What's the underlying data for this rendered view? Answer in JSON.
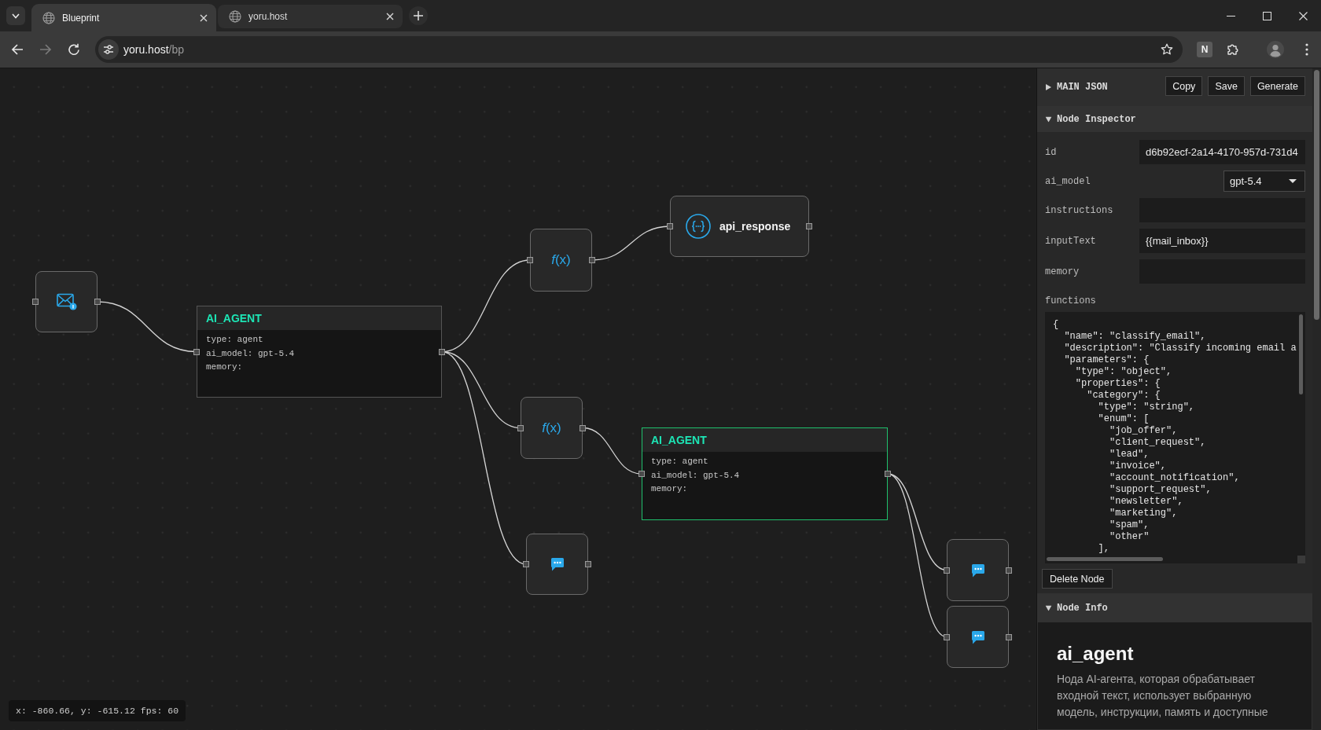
{
  "browser": {
    "tabs": [
      {
        "title": "Blueprint",
        "selected": true
      },
      {
        "title": "yoru.host",
        "selected": false
      }
    ],
    "nav_buttons": [
      {
        "kind": "back",
        "disabled": false
      },
      {
        "kind": "forward",
        "disabled": true
      },
      {
        "kind": "reload",
        "disabled": false
      }
    ],
    "address": {
      "host": "yoru.host",
      "path": "/bp"
    },
    "extension_badge": "N"
  },
  "canvas": {
    "nodes": [
      {
        "kind": "mail",
        "selected": false,
        "children": [
          {
            "kind": "agent",
            "selected": false,
            "title": "AI_AGENT",
            "fields": [
              "type: agent",
              "ai_model: gpt-5.4",
              "memory:"
            ],
            "children": [
              {
                "kind": "function",
                "selected": false,
                "label": "*f*(x)",
                "children": [
                  {
                    "kind": "response",
                    "selected": false,
                    "label": "api_response"
                  }
                ]
              },
              {
                "kind": "function",
                "selected": false,
                "label": "*f*(x)",
                "children": [
                  {
                    "kind": "agent",
                    "selected": true,
                    "title": "AI_AGENT",
                    "fields": [
                      "type: agent",
                      "ai_model: gpt-5.4",
                      "memory:"
                    ],
                    "children": [
                      {
                        "kind": "message",
                        "selected": false
                      },
                      {
                        "kind": "message",
                        "selected": false
                      }
                    ]
                  }
                ]
              },
              {
                "kind": "message",
                "selected": false
              }
            ]
          }
        ]
      }
    ],
    "status": "x: -860.66, y: -615.12 fps: 60"
  },
  "panel": {
    "main_json": {
      "title": "MAIN JSON",
      "expanded": false,
      "buttons": [
        "Copy",
        "Save",
        "Generate"
      ]
    },
    "inspector": {
      "title": "Node Inspector",
      "expanded": true,
      "fields": [
        {
          "label": "id",
          "kind": "text",
          "value": "d6b92ecf-2a14-4170-957d-731d4"
        },
        {
          "label": "ai_model",
          "kind": "select",
          "value": "gpt-5.4"
        },
        {
          "label": "instructions",
          "kind": "text"
        },
        {
          "label": "inputText",
          "kind": "text",
          "value": "{{mail_inbox}}"
        },
        {
          "label": "memory",
          "kind": "text"
        },
        {
          "label": "functions",
          "kind": "code",
          "lines": [
            "{",
            "  \"name\": \"classify_email\",",
            "  \"description\": \"Classify incoming email a",
            "  \"parameters\": {",
            "    \"type\": \"object\",",
            "    \"properties\": {",
            "      \"category\": {",
            "        \"type\": \"string\",",
            "        \"enum\": [",
            "          \"job_offer\",",
            "          \"client_request\",",
            "          \"lead\",",
            "          \"invoice\",",
            "          \"account_notification\",",
            "          \"support_request\",",
            "          \"newsletter\",",
            "          \"marketing\",",
            "          \"spam\",",
            "          \"other\"",
            "        ],"
          ]
        }
      ],
      "delete_button": "Delete Node"
    },
    "info": {
      "title": "Node Info",
      "expanded": true,
      "heading": "ai_agent",
      "description": "Нода AI-агента, которая обрабатывает входной текст, использует выбранную модель, инструкции, память и доступные"
    }
  }
}
